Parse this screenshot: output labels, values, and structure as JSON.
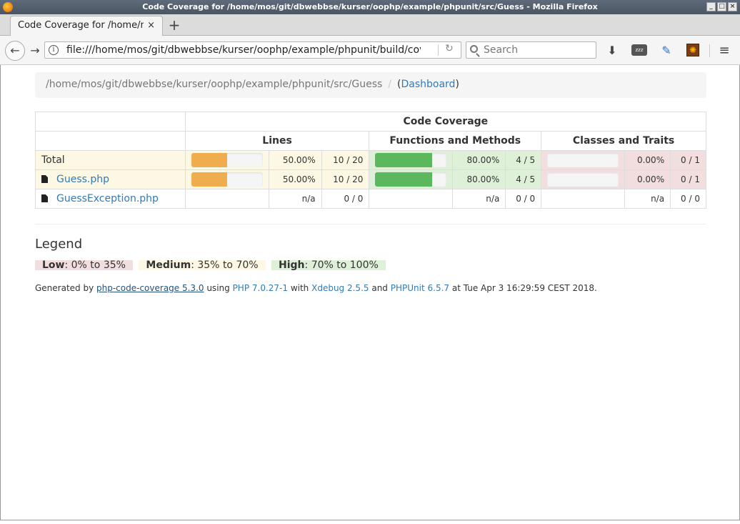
{
  "window": {
    "title": "Code Coverage for /home/mos/git/dbwebbse/kurser/oophp/example/phpunit/src/Guess - Mozilla Firefox",
    "buttons": [
      "_",
      "□",
      "×"
    ]
  },
  "tab": {
    "title": "Code Coverage for /home/mos/git/dbwebbse/kurser/oophp/example/phpunit/src/Guess",
    "close": "×",
    "new_tab": "+"
  },
  "navbar": {
    "back": "←",
    "forward": "→",
    "info": "i",
    "url": "file:///home/mos/git/dbwebbse/kurser/oophp/example/phpunit/build/coverage/Guess/index.html",
    "reload": "↻",
    "search_placeholder": "Search",
    "download": "⬇",
    "zzz": "zzz",
    "eyedropper": "✎",
    "addon": "✺",
    "menu": "≡"
  },
  "breadcrumb": {
    "path": "/home/mos/git/dbwebbse/kurser/oophp/example/phpunit/src/Guess",
    "separator": "/",
    "open_paren": "(",
    "dashboard": "Dashboard",
    "close_paren": ")"
  },
  "table": {
    "header_top": "Code Coverage",
    "header_cols": [
      "Lines",
      "Functions and Methods",
      "Classes and Traits"
    ],
    "rows": [
      {
        "name": "Total",
        "is_file": false,
        "lines": {
          "percent": 50,
          "percent_text": "50.00%",
          "ratio": "10 / 20",
          "level": "warning"
        },
        "functions": {
          "percent": 80,
          "percent_text": "80.00%",
          "ratio": "4 / 5",
          "level": "success"
        },
        "classes": {
          "percent": 0,
          "percent_text": "0.00%",
          "ratio": "0 / 1",
          "level": "danger"
        }
      },
      {
        "name": "Guess.php",
        "is_file": true,
        "lines": {
          "percent": 50,
          "percent_text": "50.00%",
          "ratio": "10 / 20",
          "level": "warning"
        },
        "functions": {
          "percent": 80,
          "percent_text": "80.00%",
          "ratio": "4 / 5",
          "level": "success"
        },
        "classes": {
          "percent": 0,
          "percent_text": "0.00%",
          "ratio": "0 / 1",
          "level": "danger"
        }
      },
      {
        "name": "GuessException.php",
        "is_file": true,
        "lines": {
          "percent": null,
          "percent_text": "n/a",
          "ratio": "0 / 0",
          "level": "none"
        },
        "functions": {
          "percent": null,
          "percent_text": "n/a",
          "ratio": "0 / 0",
          "level": "none"
        },
        "classes": {
          "percent": null,
          "percent_text": "n/a",
          "ratio": "0 / 0",
          "level": "none"
        }
      }
    ]
  },
  "legend": {
    "title": "Legend",
    "low_label": "Low",
    "low_range": ": 0% to 35%",
    "medium_label": "Medium",
    "medium_range": ": 35% to 70%",
    "high_label": "High",
    "high_range": ": 70% to 100%"
  },
  "footer": {
    "generated_by": "Generated by ",
    "tool": "php-code-coverage 5.3.0",
    "using": " using ",
    "php": "PHP 7.0.27-1",
    "with": " with ",
    "xdebug": "Xdebug 2.5.5",
    "and": " and ",
    "phpunit": "PHPUnit 6.5.7",
    "at": " at Tue Apr 3 16:29:59 CEST 2018."
  },
  "colors": {
    "link": "#337ab7",
    "warning_bg": "#fcf8e3",
    "success_bg": "#dff0d8",
    "danger_bg": "#f2dede",
    "bar_warning": "#f0ad4e",
    "bar_success": "#5cb85c"
  }
}
